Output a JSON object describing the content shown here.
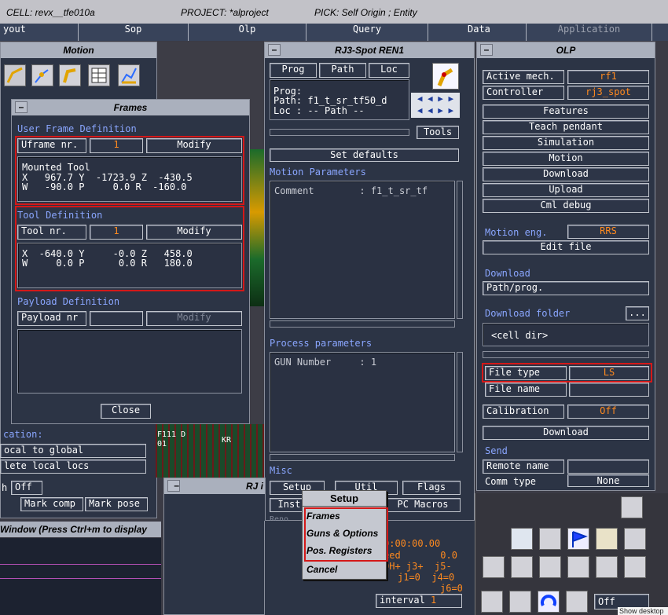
{
  "top_bar": {
    "cell": "CELL: revx__tfe010a",
    "project": "PROJECT: *alproject",
    "pick": "PICK: Self Origin ; Entity"
  },
  "menubar": {
    "layout": "yout",
    "sop": "Sop",
    "olp": "Olp",
    "query": "Query",
    "data": "Data",
    "application": "Application"
  },
  "motion": {
    "title": "Motion",
    "location": "cation:",
    "local_to_global": "ocal to global",
    "delete_local": "lete local locs",
    "toggle_value": "Off",
    "mark_comp": "Mark comp",
    "mark_pose": "Mark pose",
    "window_hint": "Window (Press Ctrl+m to display"
  },
  "frames": {
    "title": "Frames",
    "uframe_heading": "User Frame Definition",
    "uframe_label": "Uframe nr.",
    "uframe_value": "1",
    "modify": "Modify",
    "mounted": "Mounted Tool",
    "uframe_line1": "X   967.7 Y  -1723.9 Z  -430.5",
    "uframe_line2": "W   -90.0 P     0.0 R  -160.0",
    "tool_heading": "Tool Definition",
    "tool_label": "Tool nr.",
    "tool_value": "1",
    "tool_line1": "X  -640.0 Y     -0.0 Z   458.0",
    "tool_line2": "W     0.0 P      0.0 R   180.0",
    "payload_heading": "Payload Definition",
    "payload_label": "Payload nr",
    "close": "Close"
  },
  "scene": {
    "label1": "F111 D",
    "label2": "01",
    "label3": "KR"
  },
  "rj3": {
    "title": "RJ3-Spot REN1",
    "tab_prog": "Prog",
    "tab_path": "Path",
    "tab_loc": "Loc",
    "prog": "Prog:",
    "path": "Path: f1_t_sr_tf50_d",
    "loc": "Loc : -- Path --",
    "tools": "Tools",
    "set_defaults": "Set defaults",
    "motion_params": "Motion Parameters",
    "comment": "Comment        : f1_t_sr_tf",
    "process_params": "Process parameters",
    "gun": "GUN Number     : 1",
    "misc": "Misc",
    "setup": "Setup",
    "util": "Util",
    "flags": "Flags",
    "inst": "Inst",
    "pc_macros": "PC Macros",
    "reno": "Reno"
  },
  "setup_menu": {
    "title": "Setup",
    "items": [
      "Frames",
      "Guns & Options",
      "Pos. Registers",
      "Cancel"
    ]
  },
  "rj_lower": {
    "title": "RJ i",
    "time": "0:00:00.00",
    "speed": "eed       0.0",
    "joints1": "0H+ j3+  j5-",
    "joints2": "j1=0  j4=0",
    "joints3": "j6=0",
    "interval": "interval",
    "interval_value": "1"
  },
  "olp": {
    "title": "OLP",
    "active_mech": "Active mech.",
    "active_mech_value": "rf1",
    "controller": "Controller",
    "controller_value": "rj3_spot",
    "buttons": [
      "Features",
      "Teach pendant",
      "Simulation",
      "Motion",
      "Download",
      "Upload",
      "Cml debug"
    ],
    "motion_eng": "Motion eng.",
    "motion_eng_value": "RRS",
    "edit_file": "Edit file",
    "download_heading": "Download",
    "path_prog": "Path/prog.",
    "download_folder": "Download folder",
    "folder_btn": "...",
    "cell_dir": "<cell dir>",
    "file_type": "File type",
    "file_type_value": "LS",
    "file_name": "File name",
    "calibration": "Calibration",
    "calibration_value": "Off",
    "download_btn": "Download",
    "send": "Send",
    "remote_name": "Remote name",
    "comm_type": "Comm type",
    "comm_value": "None"
  },
  "toolbar": {
    "off": "Off"
  },
  "tooltip": "Show desktop",
  "colors": {
    "accent": "#ff8a1f",
    "highlight": "#d41818",
    "heading": "#8aa6ff",
    "panel": "#2c3445"
  }
}
